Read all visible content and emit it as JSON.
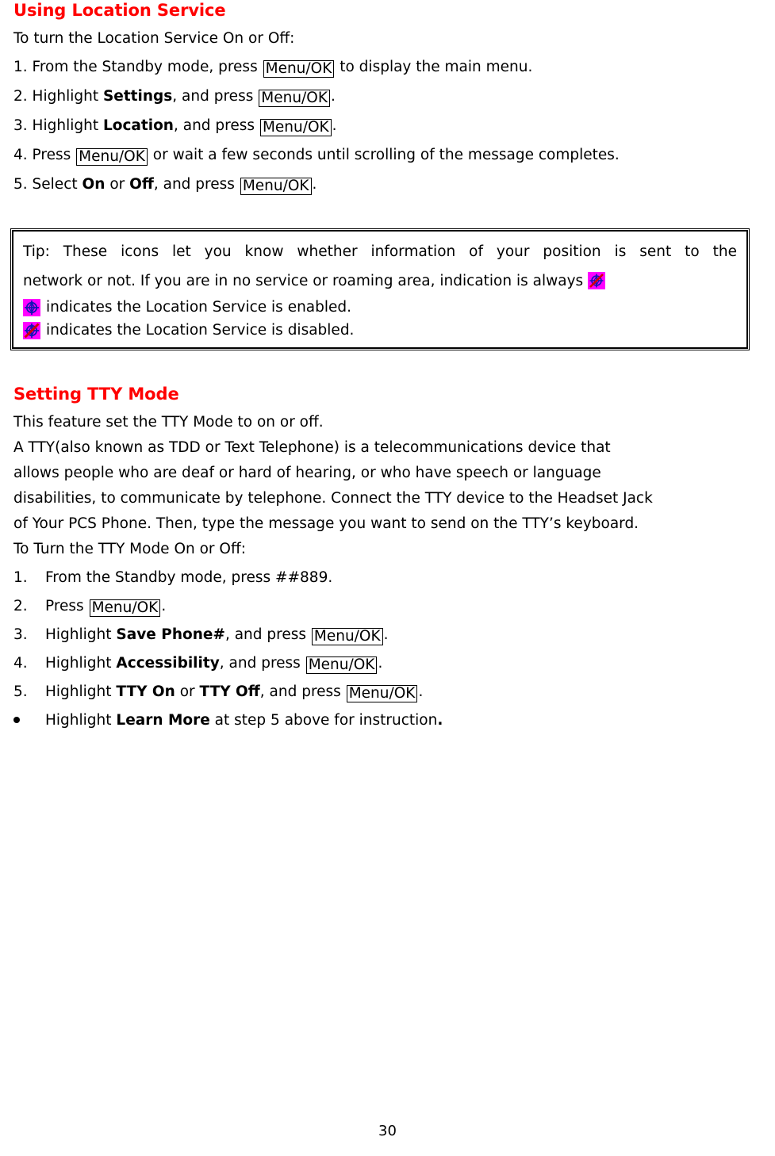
{
  "document": {
    "page_number": "30",
    "accent_color": "#ff0000",
    "icon_background_color": "#ff00ff",
    "icon_symbol_color": "#0000cc",
    "icon_slash_color": "#cc0000"
  },
  "section_location": {
    "heading": "Using Location Service",
    "intro": "To turn the Location Service On or Off:",
    "steps": [
      {
        "number": "1.",
        "pre": "From the Standby mode, press",
        "key": "Menu/OK",
        "post": "to display the main menu."
      },
      {
        "number": "2.",
        "pre": "Highlight",
        "bold": "Settings",
        "mid": ", and press",
        "key": "Menu/OK",
        "post": "."
      },
      {
        "number": "3.",
        "pre": "Highlight",
        "bold": "Location",
        "mid": ", and press",
        "key": "Menu/OK",
        "post": "."
      },
      {
        "number": "4.",
        "pre": "Press",
        "key": "Menu/OK",
        "post": "or wait a few seconds until scrolling of the message completes."
      },
      {
        "number": "5.",
        "pre": "Select",
        "bold": "On",
        "mid_or": "or",
        "bold2": "Off",
        "mid": ", and press",
        "key": "Menu/OK",
        "post": "."
      }
    ]
  },
  "tip_box": {
    "line1": "Tip: These icons let you know whether information of your position is sent to the",
    "line2": "network or not. If you are in no service or roaming area, indication is always",
    "icon_always": "location-disabled-icon",
    "enabled_icon": "location-enabled-icon",
    "enabled_text": "indicates the Location Service is enabled.",
    "disabled_icon": "location-disabled-icon",
    "disabled_text": "indicates the Location Service is disabled."
  },
  "section_tty": {
    "heading": "Setting TTY Mode",
    "paragraph_lines": [
      "This feature set the TTY Mode to on or off.",
      "A TTY(also known as TDD or Text Telephone) is a telecommunications device that",
      "allows people who are deaf or hard of hearing, or who have speech or language",
      "disabilities, to communicate by telephone. Connect the TTY device to the Headset Jack",
      "of Your PCS Phone. Then, type the message you want to send on the TTY’s keyboard.",
      "To Turn the TTY Mode On or Off:"
    ],
    "steps": [
      {
        "number": "1.",
        "pre": "From the Standby mode, press ##889.",
        "key": "",
        "post": ""
      },
      {
        "number": "2.",
        "pre": "Press",
        "key": "Menu/OK",
        "post": "."
      },
      {
        "number": "3.",
        "pre": "Highlight",
        "bold": "Save Phone#",
        "mid": ", and press",
        "key": "Menu/OK",
        "post": "."
      },
      {
        "number": "4.",
        "pre": "Highlight",
        "bold": "Accessibility",
        "mid": ", and press",
        "key": "Menu/OK",
        "post": "."
      },
      {
        "number": "5.",
        "pre": "Highlight",
        "bold": "TTY On",
        "mid_or": "or",
        "bold2": "TTY Off",
        "mid": ", and press",
        "key": "Menu/OK",
        "post": "."
      }
    ],
    "bullet": {
      "pre": "Highlight",
      "bold": "Learn More",
      "post": "at step 5 above for instruction",
      "period": "."
    }
  }
}
